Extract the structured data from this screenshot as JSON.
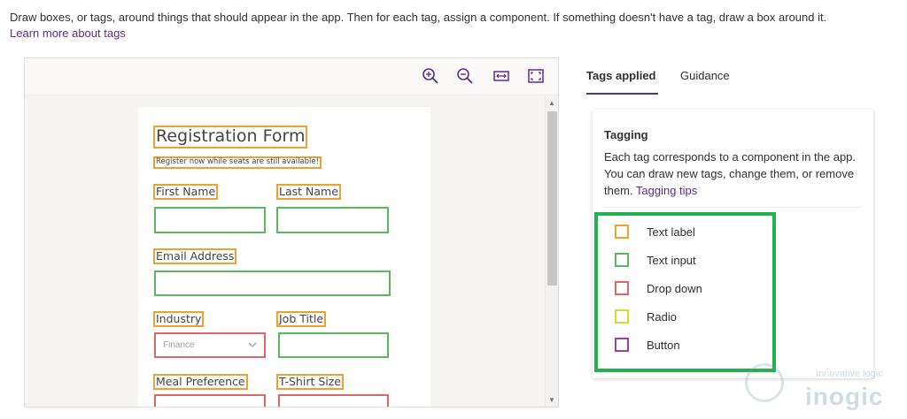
{
  "intro": {
    "text": "Draw boxes, or tags, around things that should appear in the app. Then for each tag, assign a component. If something doesn't have a tag, draw a box around it.",
    "link": "Learn more about tags"
  },
  "viewer": {
    "toolbar": {
      "zoom_in_icon": "zoom-in-icon",
      "zoom_out_icon": "zoom-out-icon",
      "fit_width_icon": "fit-width-icon",
      "fit_page_icon": "fit-page-icon"
    },
    "form": {
      "title": "Registration Form",
      "subtitle": "Register now while seats are still available!",
      "first_name": "First Name",
      "last_name": "Last Name",
      "email": "Email Address",
      "industry": "Industry",
      "industry_value": "Finance",
      "job_title": "Job Title",
      "meal": "Meal Preference",
      "tshirt": "T-Shirt Size"
    }
  },
  "tabs": {
    "active": "Tags applied",
    "other": "Guidance"
  },
  "panel": {
    "title": "Tagging",
    "description": "Each tag corresponds to a component in the app. You can draw new tags, change them, or remove them.",
    "link": "Tagging tips",
    "legend": [
      {
        "label": "Text label",
        "color": "#f0a030"
      },
      {
        "label": "Text input",
        "color": "#5cb85c"
      },
      {
        "label": "Drop down",
        "color": "#e06666"
      },
      {
        "label": "Radio",
        "color": "#d9d92a"
      },
      {
        "label": "Button",
        "color": "#a33ea8"
      }
    ],
    "highlight_color": "#23b04e"
  },
  "watermark": {
    "line1": "Innovative logic",
    "line2": "inogic"
  },
  "colors": {
    "accent": "#5c2d91",
    "label_tag": "#f0a030",
    "input_tag": "#5cb85c",
    "dropdown_tag": "#e06666"
  }
}
